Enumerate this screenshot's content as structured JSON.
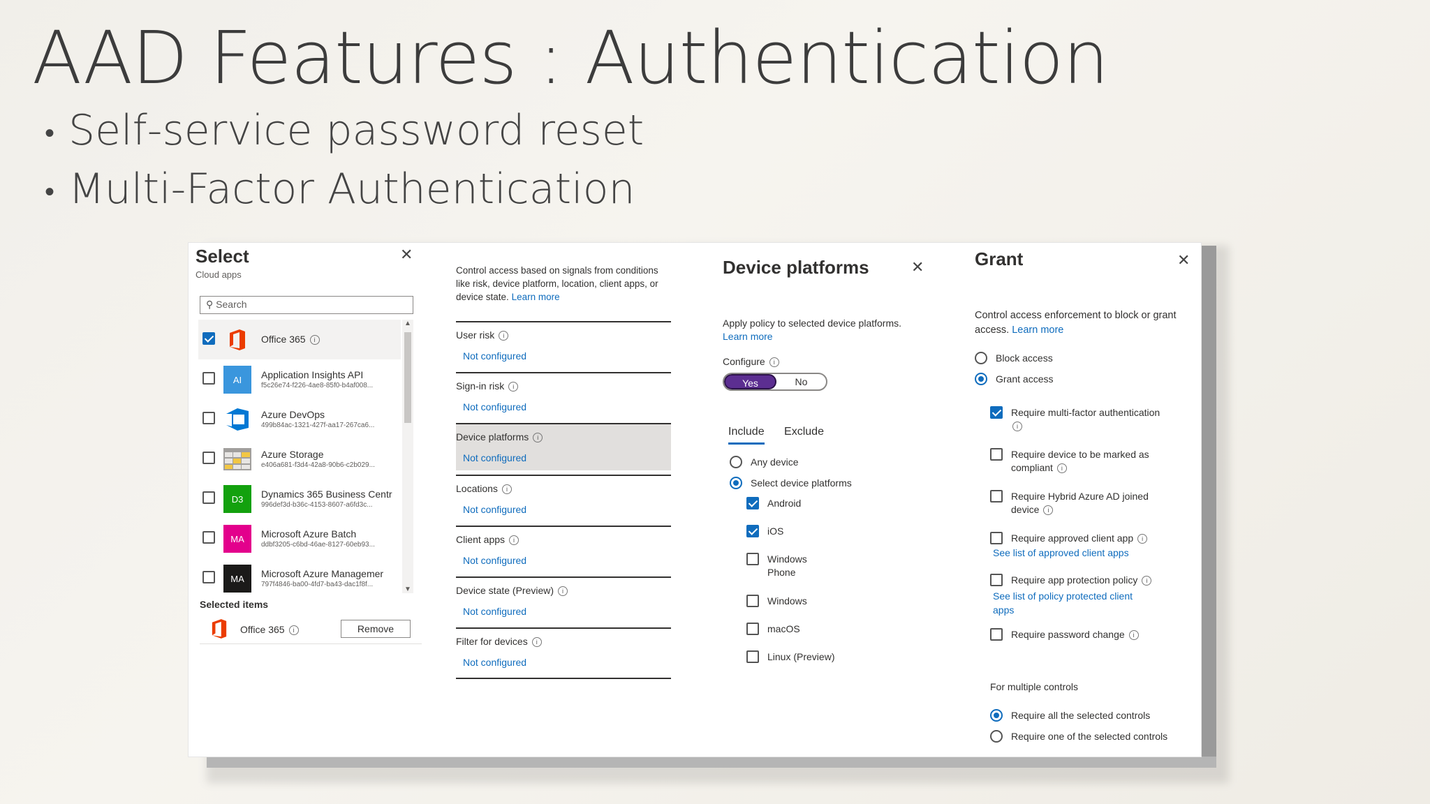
{
  "slide": {
    "title": "AAD Features : Authentication",
    "bullets": [
      "Self-service password reset",
      "Multi-Factor Authentication"
    ]
  },
  "select_pane": {
    "title": "Select",
    "subtitle": "Cloud apps",
    "search_placeholder": "Search",
    "apps": [
      {
        "name": "Office 365",
        "id": "",
        "checked": true,
        "logo": "office-icon",
        "color": "#eb3c00"
      },
      {
        "name": "Application Insights API",
        "id": "f5c26e74-f226-4ae8-85f0-b4af008...",
        "checked": false,
        "logo": "AI",
        "color": "#3a96dd"
      },
      {
        "name": "Azure DevOps",
        "id": "499b84ac-1321-427f-aa17-267ca6...",
        "checked": false,
        "logo": "devops-icon",
        "color": "#0078d4"
      },
      {
        "name": "Azure Storage",
        "id": "e406a681-f3d4-42a8-90b6-c2b029...",
        "checked": false,
        "logo": "storage-icon",
        "color": "#b8b8b8"
      },
      {
        "name": "Dynamics 365 Business Centr",
        "id": "996def3d-b36c-4153-8607-a6fd3c...",
        "checked": false,
        "logo": "D3",
        "color": "#13a10e"
      },
      {
        "name": "Microsoft Azure Batch",
        "id": "ddbf3205-c6bd-46ae-8127-60eb93...",
        "checked": false,
        "logo": "MA",
        "color": "#e3008c"
      },
      {
        "name": "Microsoft Azure Managemer",
        "id": "797f4846-ba00-4fd7-ba43-dac1f8f...",
        "checked": false,
        "logo": "MA",
        "color": "#1b1a19"
      }
    ],
    "selected_heading": "Selected items",
    "selected_item": "Office 365",
    "remove_label": "Remove"
  },
  "conditions_pane": {
    "description": "Control access based on signals from conditions like risk, device platform, location, client apps, or device state.",
    "learn_more": "Learn more",
    "conditions": [
      {
        "label": "User risk",
        "value": "Not configured"
      },
      {
        "label": "Sign-in risk",
        "value": "Not configured"
      },
      {
        "label": "Device platforms",
        "value": "Not configured"
      },
      {
        "label": "Locations",
        "value": "Not configured"
      },
      {
        "label": "Client apps",
        "value": "Not configured"
      },
      {
        "label": "Device state (Preview)",
        "value": "Not configured"
      },
      {
        "label": "Filter for devices",
        "value": "Not configured"
      }
    ]
  },
  "device_pane": {
    "title": "Device platforms",
    "description": "Apply policy to selected device platforms.",
    "learn_more": "Learn more",
    "configure_label": "Configure",
    "toggle_yes": "Yes",
    "toggle_no": "No",
    "tab_include": "Include",
    "tab_exclude": "Exclude",
    "any_device": "Any device",
    "select_platforms": "Select device platforms",
    "platforms": [
      {
        "label": "Android",
        "checked": true
      },
      {
        "label": "iOS",
        "checked": true
      },
      {
        "label": "Windows Phone",
        "checked": false
      },
      {
        "label": "Windows",
        "checked": false
      },
      {
        "label": "macOS",
        "checked": false
      },
      {
        "label": "Linux (Preview)",
        "checked": false
      }
    ]
  },
  "grant_pane": {
    "title": "Grant",
    "description": "Control access enforcement to block or grant access.",
    "learn_more": "Learn more",
    "block_access": "Block access",
    "grant_access": "Grant access",
    "controls": [
      {
        "label": "Require multi-factor authentication",
        "checked": true,
        "link": ""
      },
      {
        "label": "Require device to be marked as compliant",
        "checked": false,
        "link": ""
      },
      {
        "label": "Require Hybrid Azure AD joined device",
        "checked": false,
        "link": ""
      },
      {
        "label": "Require approved client app",
        "checked": false,
        "link": "See list of approved client apps"
      },
      {
        "label": "Require app protection policy",
        "checked": false,
        "link": "See list of policy protected client apps"
      },
      {
        "label": "Require password change",
        "checked": false,
        "link": ""
      }
    ],
    "multiple_heading": "For multiple controls",
    "require_all": "Require all the selected controls",
    "require_one": "Require one of the selected controls"
  }
}
